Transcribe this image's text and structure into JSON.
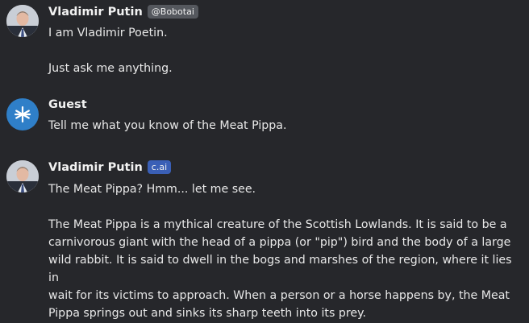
{
  "messages": [
    {
      "author": "Vladimir Putin",
      "badge": "@Bobotai",
      "avatar_icon": "user-photo-icon",
      "lines": [
        "I am Vladimir Poetin.",
        "",
        "Just ask me anything."
      ]
    },
    {
      "author": "Guest",
      "badge": "",
      "avatar_icon": "snowflake-icon",
      "lines": [
        "Tell me what you know of the Meat Pippa."
      ]
    },
    {
      "author": "Vladimir Putin",
      "badge": "c.ai",
      "avatar_icon": "user-photo-icon",
      "lines": [
        "The Meat Pippa? Hmm... let me see.",
        "",
        "The Meat Pippa is a mythical creature of the Scottish Lowlands. It is said to be a",
        "carnivorous giant with the head of a pippa (or \"pip\") bird and the body of a large",
        "wild rabbit. It is said to dwell in the bogs and marshes of the region, where it lies in",
        "wait for its victims to approach. When a person or a horse happens by, the Meat",
        "Pippa springs out and sinks its sharp teeth into its prey."
      ]
    }
  ],
  "colors": {
    "background": "#26272b",
    "guest_avatar": "#2f7fc8",
    "badge_gray": "#55585e",
    "badge_blue": "#3a5fb6"
  }
}
